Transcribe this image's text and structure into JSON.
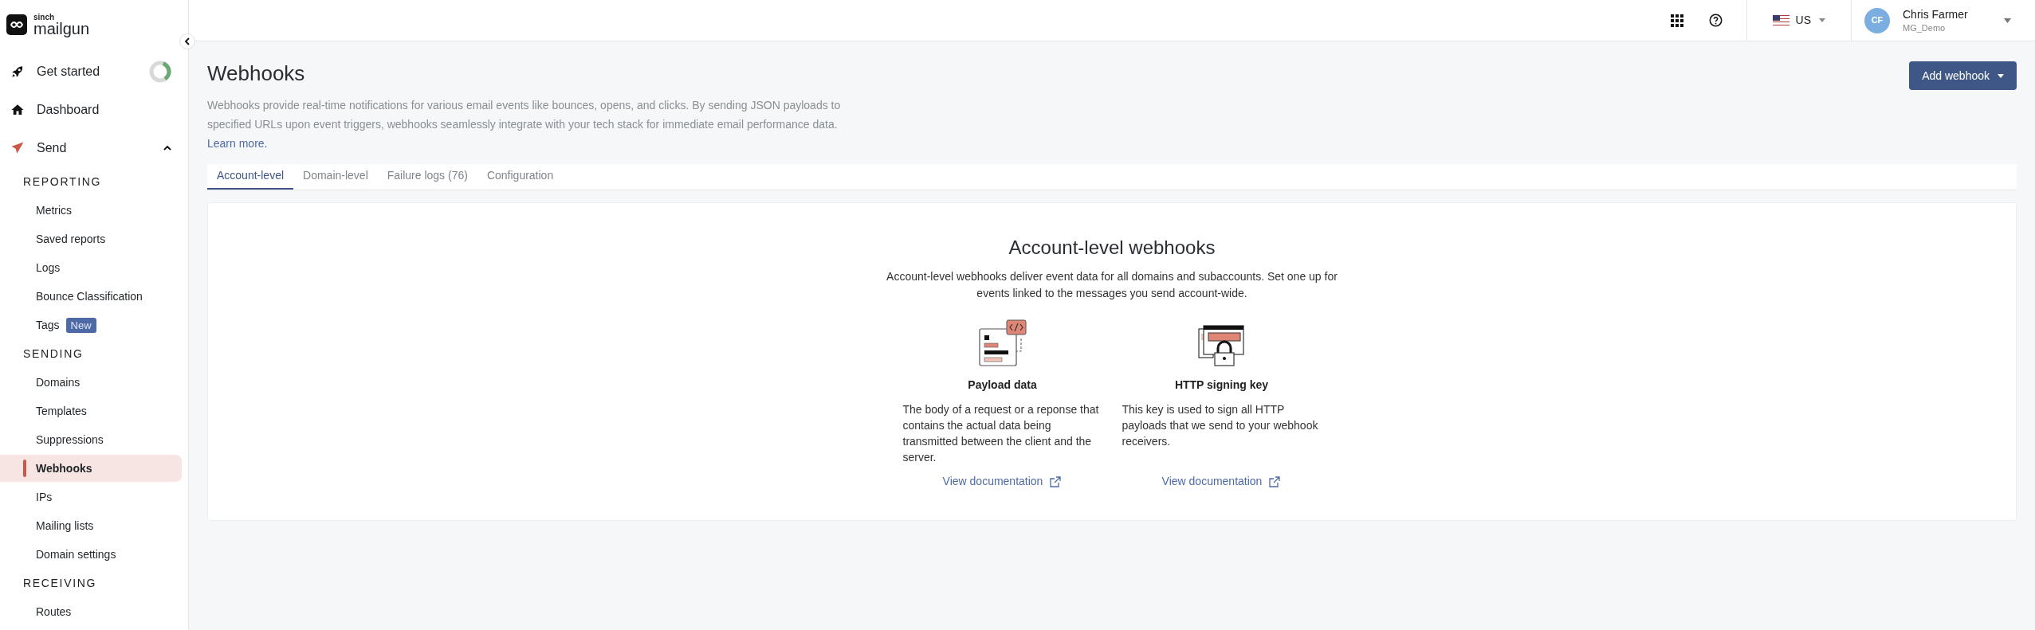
{
  "logo": {
    "brand_small": "sinch",
    "brand": "mailgun"
  },
  "sidebar": {
    "items": [
      {
        "kind": "rocket",
        "label": "Get started",
        "level": 0.35
      },
      {
        "kind": "home",
        "label": "Dashboard"
      },
      {
        "kind": "send",
        "label": "Send",
        "expanded": true
      }
    ],
    "groups": [
      {
        "heading": "REPORTING",
        "items": [
          {
            "label": "Metrics",
            "selected": false
          },
          {
            "label": "Saved reports",
            "selected": false
          },
          {
            "label": "Logs",
            "selected": false
          },
          {
            "label": "Bounce Classification",
            "selected": false
          },
          {
            "label": "Tags",
            "selected": false,
            "badge": "New"
          }
        ]
      },
      {
        "heading": "SENDING",
        "items": [
          {
            "label": "Domains",
            "selected": false
          },
          {
            "label": "Templates",
            "selected": false
          },
          {
            "label": "Suppressions",
            "selected": false
          },
          {
            "label": "Webhooks",
            "selected": true
          },
          {
            "label": "IPs",
            "selected": false
          },
          {
            "label": "Mailing lists",
            "selected": false
          },
          {
            "label": "Domain settings",
            "selected": false
          }
        ]
      },
      {
        "heading": "RECEIVING",
        "items": [
          {
            "label": "Routes",
            "selected": false
          }
        ]
      }
    ]
  },
  "header": {
    "region": "US",
    "user": {
      "initials": "CF",
      "name": "Chris Farmer",
      "account": "MG_Demo"
    }
  },
  "page": {
    "title": "Webhooks",
    "description": "Webhooks provide real-time notifications for various email events like bounces, opens, and clicks. By sending JSON payloads to specified URLs upon event triggers, webhooks seamlessly integrate with your tech stack for immediate email performance data.",
    "learn_more": "Learn more.",
    "add_button": "Add webhook"
  },
  "tabs": [
    {
      "label": "Account-level",
      "selected": true
    },
    {
      "label": "Domain-level",
      "selected": false
    },
    {
      "label": "Failure logs (76)",
      "selected": false
    },
    {
      "label": "Configuration",
      "selected": false
    }
  ],
  "panel": {
    "title": "Account-level webhooks",
    "description": "Account-level webhooks deliver event data for all domains and subaccounts. Set one up for events linked to the messages you send account-wide.",
    "features": [
      {
        "kind": "payload",
        "title": "Payload data",
        "text": "The body of a request or a reponse that contains the actual data being transmitted between the client and the server.",
        "link": "View documentation"
      },
      {
        "kind": "key",
        "title": "HTTP signing key",
        "text": "This key is used to sign all HTTP payloads that we send to your webhook receivers.",
        "link": "View documentation"
      }
    ]
  }
}
